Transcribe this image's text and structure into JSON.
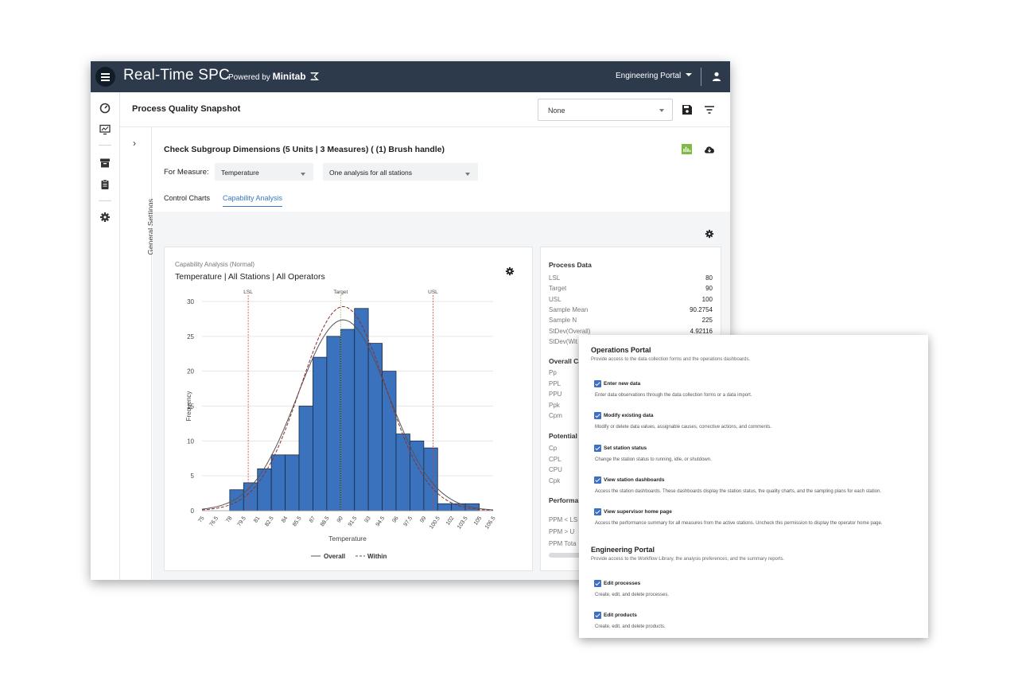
{
  "topbar": {
    "app_title": "Real-Time SPC",
    "powered_prefix": "Powered by",
    "powered_brand": "Minitab",
    "portal_label": "Engineering Portal"
  },
  "header": {
    "page_title": "Process Quality Snapshot",
    "select_value": "None"
  },
  "settings": {
    "label": "General Settings"
  },
  "analysis": {
    "title": "Check Subgroup Dimensions (5 Units | 3 Measures) ( (1) Brush handle)",
    "for_measure_label": "For Measure:",
    "measure_value": "Temperature",
    "analysis_mode": "One analysis for all stations",
    "tabs": [
      {
        "label": "Control Charts",
        "active": false
      },
      {
        "label": "Capability Analysis",
        "active": true
      }
    ]
  },
  "chart_card": {
    "subtitle": "Capability Analysis (Normal)",
    "title": "Temperature | All Stations | All Operators"
  },
  "chart_data": {
    "type": "bar",
    "title": "Temperature | All Stations | All Operators",
    "xlabel": "Temperature",
    "ylabel": "Frequency",
    "ylim": [
      0,
      30
    ],
    "yticks": [
      "0",
      "5",
      "10",
      "15",
      "20",
      "25",
      "30"
    ],
    "xticks": [
      "75",
      "76.5",
      "78",
      "79.5",
      "81",
      "82.5",
      "84",
      "85.5",
      "87",
      "88.5",
      "90",
      "91.5",
      "93",
      "94.5",
      "96",
      "97.5",
      "99",
      "100.5",
      "102",
      "103.5",
      "105",
      "106.5"
    ],
    "bin_start": 78,
    "bin_width": 1.5,
    "values": [
      3,
      4,
      6,
      8,
      8,
      15,
      22,
      25,
      26,
      29,
      24,
      20,
      11,
      10,
      9,
      1,
      1,
      1
    ],
    "xlim": [
      75,
      106.5
    ],
    "reference_lines": [
      {
        "label": "LSL",
        "x": 80
      },
      {
        "label": "Target",
        "x": 90
      },
      {
        "label": "USL",
        "x": 100
      }
    ],
    "legend": [
      {
        "name": "Overall",
        "style": "solid"
      },
      {
        "name": "Within",
        "style": "dashed"
      }
    ],
    "legend_position": "bottom",
    "bar_color": "#3a72bd",
    "grid": true
  },
  "process_data": {
    "title": "Process Data",
    "rows": [
      {
        "label": "LSL",
        "value": "80"
      },
      {
        "label": "Target",
        "value": "90"
      },
      {
        "label": "USL",
        "value": "100"
      },
      {
        "label": "Sample Mean",
        "value": "90.2754"
      },
      {
        "label": "Sample N",
        "value": "225"
      },
      {
        "label": "StDev(Overall)",
        "value": "4.92116"
      },
      {
        "label": "StDev(Wit",
        "value": ""
      }
    ],
    "overall_title": "Overall Ca",
    "overall_labels": [
      "Pp",
      "PPL",
      "PPU",
      "Ppk",
      "Cpm"
    ],
    "potential_title": "Potential",
    "potential_labels": [
      "Cp",
      "CPL",
      "CPU",
      "Cpk"
    ],
    "performance_title": "Performa",
    "performance_labels": [
      "PPM < LS",
      "PPM > U",
      "PPM Tota"
    ]
  },
  "permissions": {
    "operations": {
      "title": "Operations Portal",
      "desc": "Provide access to the data collection forms and the operations dashboards.",
      "items": [
        {
          "label": "Enter new data",
          "desc": "Enter data observations through the data collection forms or a data import."
        },
        {
          "label": "Modify existing data",
          "desc": "Modify or delete data values, assignable causes, corrective actions, and comments."
        },
        {
          "label": "Set station status",
          "desc": "Change the station status to running, idle, or shutdown."
        },
        {
          "label": "View station dashboards",
          "desc": "Access the station dashboards. These dashboards display the station status, the quality charts, and the sampling plans for each station."
        },
        {
          "label": "View supervisor home page",
          "desc": "Access the performance summary for all measures from the active stations. Uncheck this permission to display the operator home page."
        }
      ]
    },
    "engineering": {
      "title": "Engineering Portal",
      "desc": "Provide access to the Workflow Library, the analysis preferences, and the summary reports.",
      "items": [
        {
          "label": "Edit processes",
          "desc": "Create, edit, and delete processes."
        },
        {
          "label": "Edit products",
          "desc": "Create, edit, and delete products."
        }
      ]
    }
  }
}
